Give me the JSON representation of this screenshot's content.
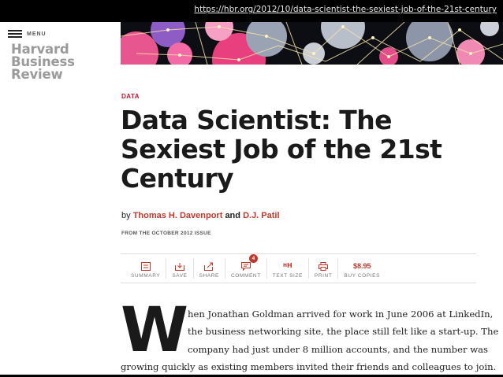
{
  "browser": {
    "url": "https://hbr.org/2012/10/data-scientist-the-sexiest-job-of-the-21st-century"
  },
  "header": {
    "menu_label": "MENU",
    "logo_lines": [
      "Harvard",
      "Business",
      "Review"
    ],
    "hero_icon": "abstract-network-illustration"
  },
  "article": {
    "section": "DATA",
    "title": "Data Scientist: The Sexiest Job of the 21st Century",
    "byline": {
      "prefix": "by",
      "author1": "Thomas H. Davenport",
      "conjunction": "and",
      "author2": "D.J. Patil"
    },
    "issue": "FROM THE OCTOBER 2012 ISSUE",
    "dropcap": "W",
    "body_lines": [
      "hen Jonathan Goldman arrived for work in June 2006 at LinkedIn,",
      "the business networking site, the place still felt like a start-up. The",
      "company had just under 8 million accounts, and the number was",
      "growing quickly as existing members invited their friends and colleagues to join."
    ]
  },
  "toolbar": {
    "summary": "SUMMARY",
    "save": "SAVE",
    "share": "SHARE",
    "comment": "COMMENT",
    "comment_count": "4",
    "text_size": "TEXT SIZE",
    "print": "PRINT",
    "price": "$8.95",
    "buy_copies": "BUY COPIES"
  },
  "colors": {
    "accent": "#c0392b",
    "section_red": "#c8102e",
    "logo_gray": "#9a9a9a",
    "hero_bg": "#0d0d14"
  }
}
